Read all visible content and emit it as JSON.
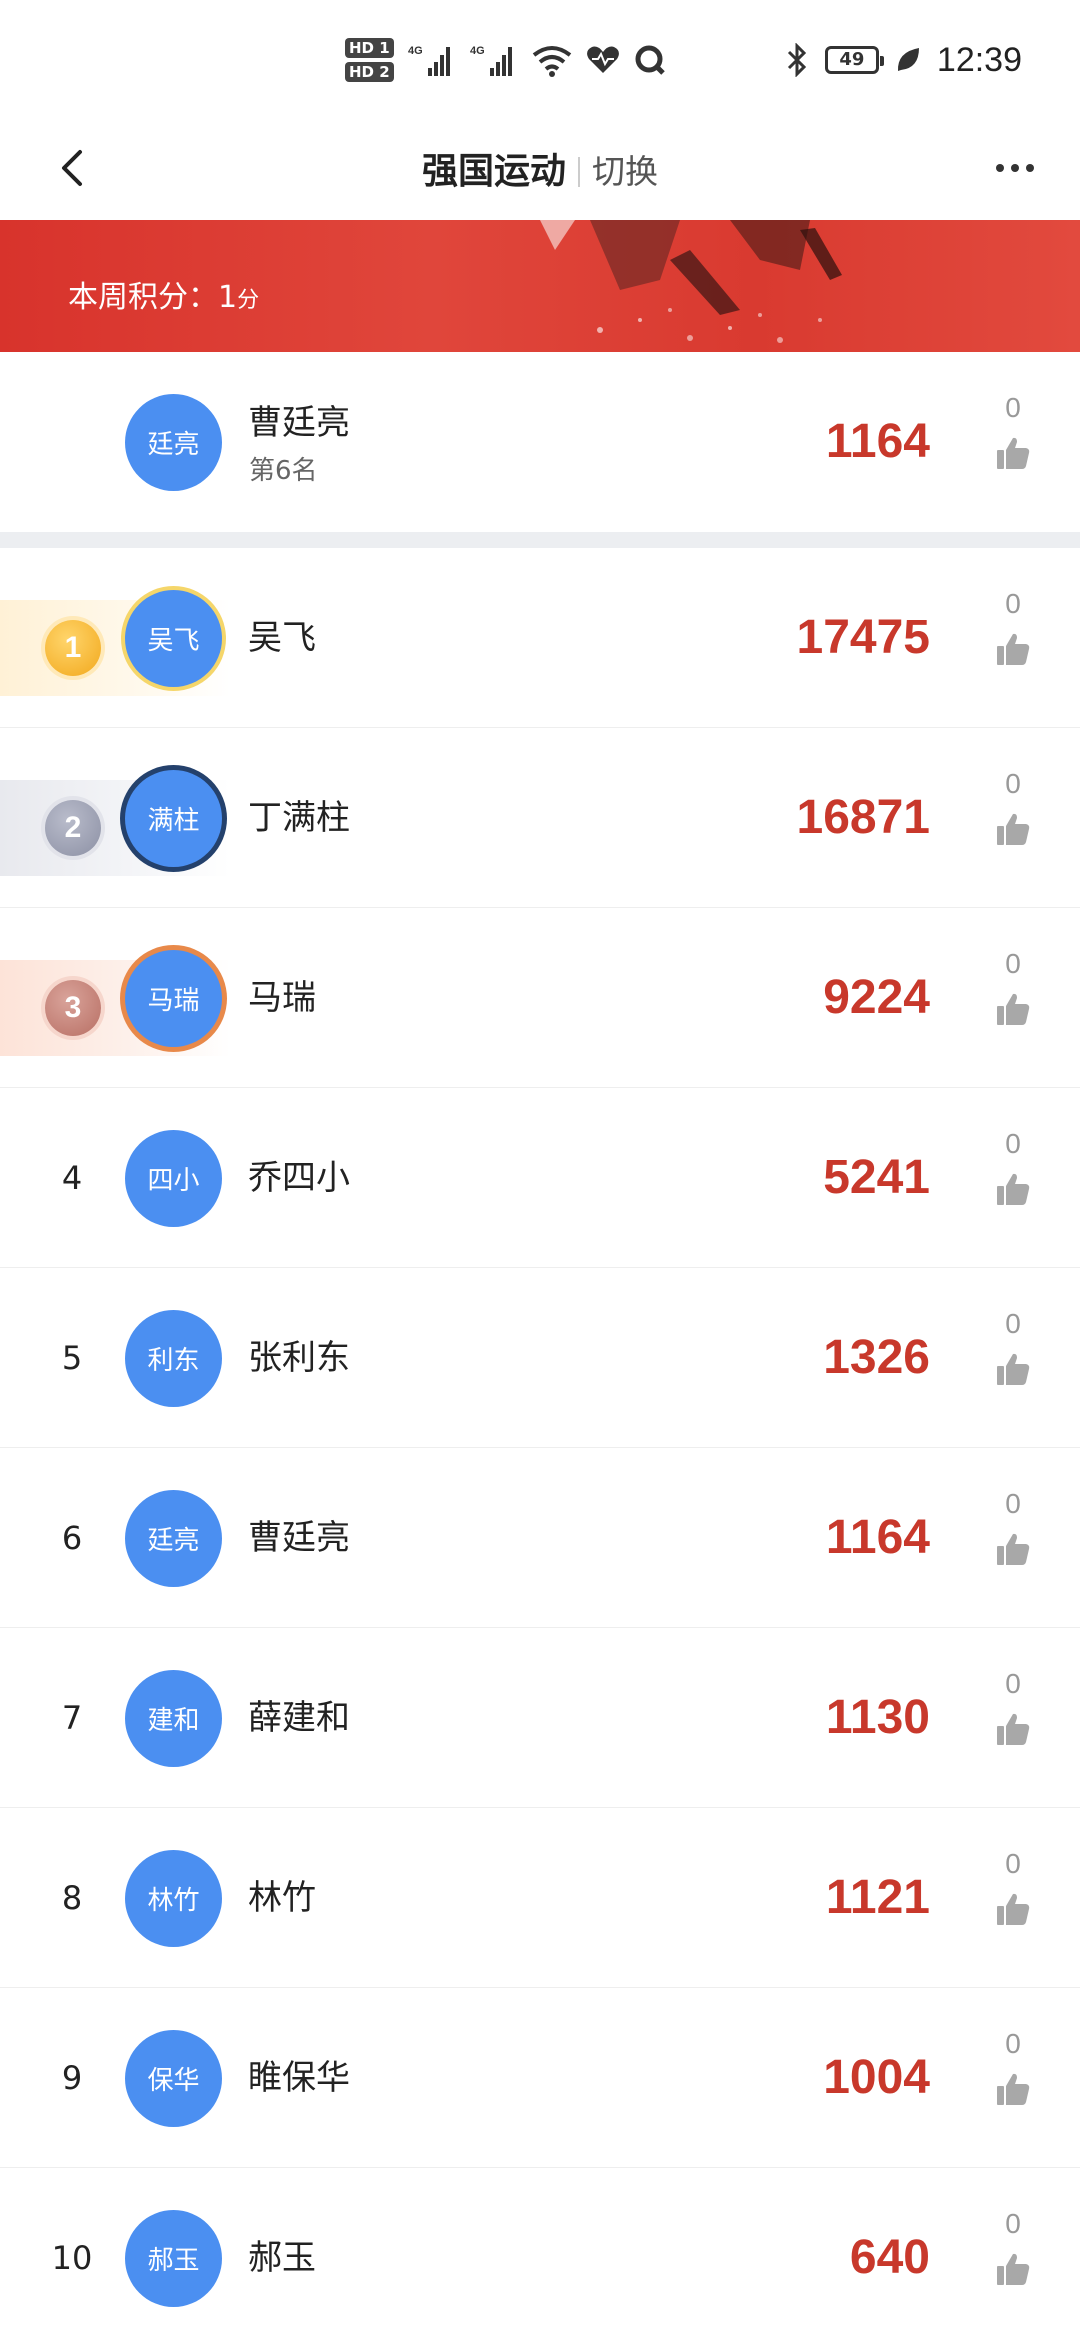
{
  "status_bar": {
    "sim_labels": [
      "HD 1",
      "HD 2"
    ],
    "network": [
      "4G",
      "4G"
    ],
    "battery_level": "49",
    "time": "12:39",
    "icons": [
      "signal-icon",
      "wifi-icon",
      "health-icon",
      "search-app-icon",
      "bluetooth-icon",
      "battery-icon",
      "leaf-icon"
    ]
  },
  "nav": {
    "title": "强国运动",
    "switch_label": "切换",
    "back_icon": "chevron-left-icon",
    "more_icon": "more-dots-icon"
  },
  "banner": {
    "weekly_score_label": "本周积分：",
    "weekly_score_value": "1",
    "weekly_score_unit": "分"
  },
  "self": {
    "avatar_text": "廷亮",
    "name": "曹廷亮",
    "rank_text": "第6名",
    "score": "1164",
    "likes": "0"
  },
  "ranking": [
    {
      "rank": "1",
      "avatar_text": "吴飞",
      "name": "吴飞",
      "score": "17475",
      "likes": "0"
    },
    {
      "rank": "2",
      "avatar_text": "满柱",
      "name": "丁满柱",
      "score": "16871",
      "likes": "0"
    },
    {
      "rank": "3",
      "avatar_text": "马瑞",
      "name": "马瑞",
      "score": "9224",
      "likes": "0"
    },
    {
      "rank": "4",
      "avatar_text": "四小",
      "name": "乔四小",
      "score": "5241",
      "likes": "0"
    },
    {
      "rank": "5",
      "avatar_text": "利东",
      "name": "张利东",
      "score": "1326",
      "likes": "0"
    },
    {
      "rank": "6",
      "avatar_text": "廷亮",
      "name": "曹廷亮",
      "score": "1164",
      "likes": "0"
    },
    {
      "rank": "7",
      "avatar_text": "建和",
      "name": "薛建和",
      "score": "1130",
      "likes": "0"
    },
    {
      "rank": "8",
      "avatar_text": "林竹",
      "name": "林竹",
      "score": "1121",
      "likes": "0"
    },
    {
      "rank": "9",
      "avatar_text": "保华",
      "name": "睢保华",
      "score": "1004",
      "likes": "0"
    },
    {
      "rank": "10",
      "avatar_text": "郝玉",
      "name": "郝玉",
      "score": "640",
      "likes": "0"
    }
  ],
  "colors": {
    "accent_red": "#c8382b",
    "banner_red": "#d8332c",
    "avatar_blue": "#4b8ff1",
    "gold": "#f2a81c",
    "silver": "#8c90a4",
    "bronze": "#b86f64"
  }
}
